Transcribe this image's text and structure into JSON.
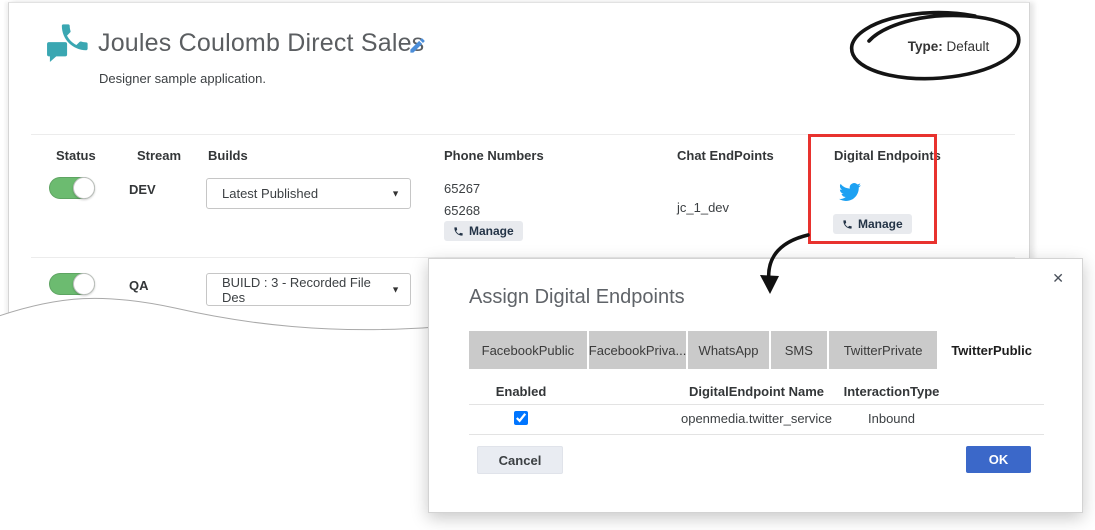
{
  "header": {
    "title": "Joules Coulomb Direct Sales",
    "subtitle": "Designer sample application.",
    "type_label": "Type:",
    "type_value": "Default"
  },
  "table": {
    "headers": {
      "status": "Status",
      "stream": "Stream",
      "builds": "Builds",
      "phone_numbers": "Phone Numbers",
      "chat_endpoints": "Chat EndPoints",
      "digital_endpoints": "Digital Endpoints"
    },
    "rows": [
      {
        "stream": "DEV",
        "status_on": true,
        "build_selected": "Latest Published",
        "phones": [
          "65267",
          "65268"
        ],
        "phone_manage_label": "Manage",
        "chat_endpoint": "jc_1_dev",
        "digital_manage_label": "Manage"
      },
      {
        "stream": "QA",
        "status_on": true,
        "build_selected": "BUILD : 3 - Recorded File Des"
      }
    ]
  },
  "modal": {
    "title": "Assign Digital Endpoints",
    "tabs": [
      "FacebookPublic",
      "FacebookPriva...",
      "WhatsApp",
      "SMS",
      "TwitterPrivate",
      "TwitterPublic"
    ],
    "active_tab": "TwitterPublic",
    "table": {
      "headers": [
        "Enabled",
        "DigitalEndpoint Name",
        "InteractionType"
      ],
      "rows": [
        {
          "enabled": true,
          "name": "openmedia.twitter_service",
          "interaction_type": "Inbound"
        }
      ]
    },
    "cancel_label": "Cancel",
    "ok_label": "OK"
  },
  "icons": {
    "dropdown_caret": "▼",
    "close": "✕"
  },
  "colors": {
    "brand_teal": "#3aa7b2",
    "pencil_blue": "#4c8ed9",
    "toggle_green": "#6cbb70",
    "twitter_blue": "#1da1f2",
    "ok_blue": "#3b68c9",
    "highlight_red": "#e8322e",
    "tab_gray": "#cacaca"
  }
}
